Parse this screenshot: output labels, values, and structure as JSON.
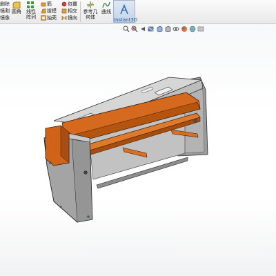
{
  "ribbon": {
    "left_cut": [
      "删除",
      "镜割",
      "镜像"
    ],
    "fillet": "圆角",
    "linear_pattern": "线性阵列",
    "rib": "筋",
    "draft": "拔模",
    "shell": "抽壳",
    "wrap": "包覆",
    "intersect": "相交",
    "mirror": "镜向",
    "ref_geometry": "参考几何体",
    "curves": "曲线",
    "instant3d": "Instant3D"
  },
  "heads_up": {
    "icons": [
      "zoom-to-fit",
      "zoom-to-area",
      "previous-view",
      "section-view",
      "view-orientation",
      "display-style",
      "hide-show-items",
      "edit-appearance",
      "apply-scene",
      "view-settings"
    ]
  },
  "colors": {
    "ribbon_bg": "#efefef",
    "instant3d_active": "#c9d8ea",
    "part_orange": "#d4691f",
    "part_grey": "#a9a9a9",
    "part_dark": "#6c6c6c"
  }
}
